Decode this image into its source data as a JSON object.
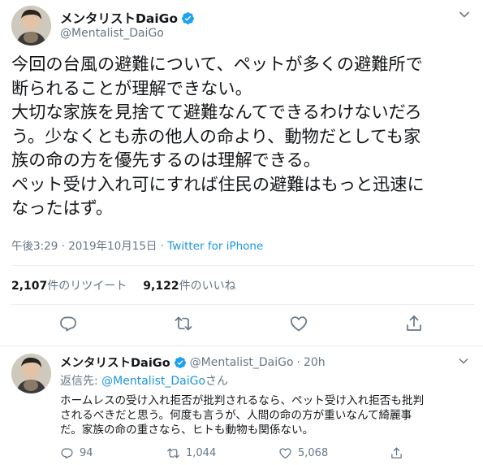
{
  "main_tweet": {
    "display_name": "メンタリストDaiGo",
    "handle": "@Mentalist_DaiGo",
    "text": "今回の台風の避難について、ペットが多くの避難所で\n断られることが理解できない。\n大切な家族を見捨てて避難なんてできるわけないだろ\nう。少なくとも赤の他人の命より、動物だとしても家\n族の命の方を優先するのは理解できる。\nペット受け入れ可にすれば住民の避難はもっと迅速に\nなったはず。",
    "time": "午後3:29",
    "separator": " · ",
    "date": "2019年10月15日",
    "source": "Twitter for iPhone",
    "retweets": {
      "count": "2,107",
      "label": "件のリツイート"
    },
    "likes": {
      "count": "9,122",
      "label": "件のいいね"
    }
  },
  "reply_tweet": {
    "display_name": "メンタリストDaiGo",
    "handle": "@Mentalist_DaiGo",
    "dot": "·",
    "time": "20h",
    "reply_to_prefix": "返信先: ",
    "reply_to_mention": "@Mentalist_DaiGo",
    "reply_to_suffix": "さん",
    "text": "ホームレスの受け入れ拒否が批判されるなら、ペット受け入れ拒否も批判\nされるべきだと思う。何度も言うが、人間の命の方が重いなんて綺麗事\nだ。家族の命の重さなら、ヒトも動物も関係ない。",
    "reply_count": "94",
    "retweet_count": "1,044",
    "like_count": "5,068"
  },
  "icons": [
    "verified-badge-icon",
    "chevron-down-icon",
    "reply-icon",
    "retweet-icon",
    "like-icon",
    "share-icon"
  ],
  "colors": {
    "link": "#1b95e0",
    "secondary": "#657786",
    "text": "#14171a",
    "divider": "#e6ecf0"
  }
}
